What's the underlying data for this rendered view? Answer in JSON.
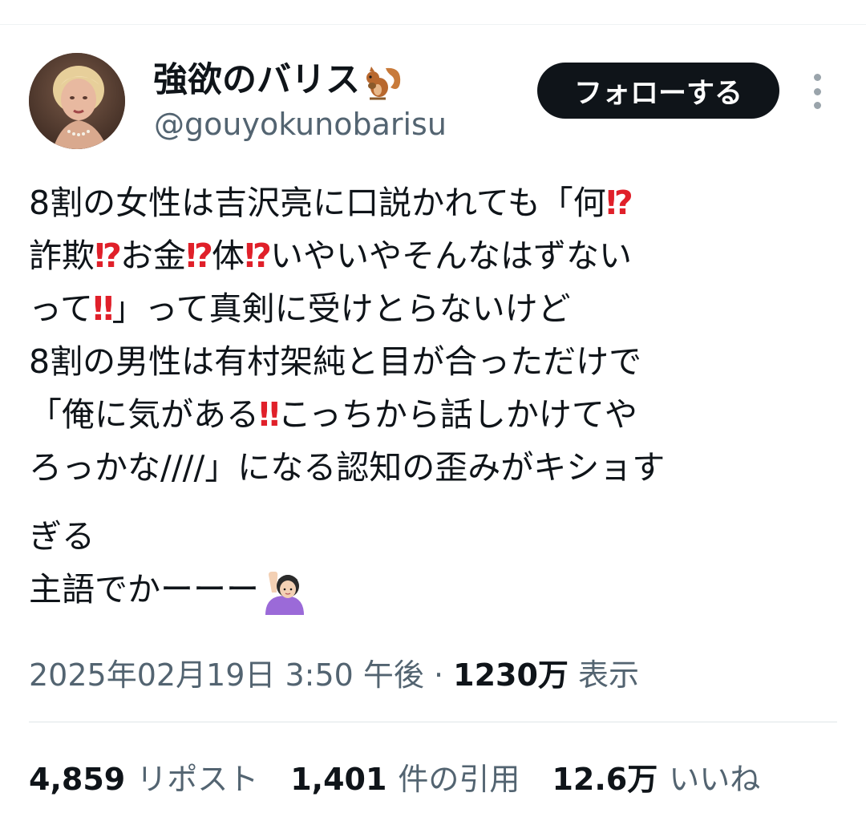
{
  "user": {
    "display_name": "強欲のバリス",
    "handle": "@gouyokunobarisu",
    "avatar_icon": "profile-photo",
    "badge_emoji": "squirrel-emoji"
  },
  "actions": {
    "follow_label": "フォローする",
    "more_icon": "more-vertical-icon"
  },
  "tweet": {
    "lines": [
      "8割の女性は吉沢亮に口説かれても「何",
      "詐欺",
      "お金",
      "体",
      "いやいやそんなはずない",
      "って",
      "」って真剣に受けとらないけど",
      "8割の男性は有村架純と目が合っただけで",
      "「俺に気がある",
      "こっちから話しかけてや",
      "ろっかな////」になる認知の歪みがキショす",
      "ぎる",
      "主語でかーーー"
    ],
    "emoji": {
      "interrobang": "⁉",
      "double_exclamation": "‼"
    },
    "end_emoji": "person-raising-hand-emoji",
    "accent_color": "#e0202a"
  },
  "meta": {
    "timestamp": "2025年02月19日 3:50 午後 · ",
    "views_count": "1230万",
    "views_label": " 表示"
  },
  "stats": {
    "reposts_count": "4,859",
    "reposts_label": "リポスト",
    "quotes_count": "1,401",
    "quotes_label": "件の引用",
    "likes_count": "12.6万",
    "likes_label": "いいね"
  },
  "colors": {
    "text_primary": "#0f1419",
    "text_secondary": "#536471",
    "button_bg": "#0f1419",
    "divider": "#dfe5e8"
  }
}
